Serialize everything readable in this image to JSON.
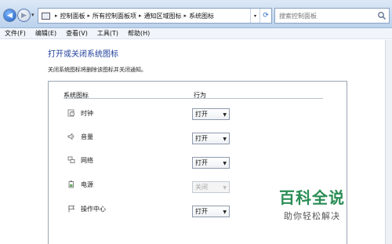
{
  "address_bar": {
    "breadcrumbs": [
      "控制面板",
      "所有控制面板项",
      "通知区域图标",
      "系统图标"
    ]
  },
  "search": {
    "placeholder": "搜索控制面板"
  },
  "menu": [
    "文件(F)",
    "编辑(E)",
    "查看(V)",
    "工具(T)",
    "帮助(H)"
  ],
  "page": {
    "title": "打开或关闭系统图标",
    "description": "关闭系统图标将删除该图标并关闭通知。"
  },
  "table": {
    "headers": {
      "icon": "系统图标",
      "behavior": "行为"
    },
    "rows": [
      {
        "icon": "clock-icon",
        "label": "时钟",
        "value": "打开",
        "enabled": true
      },
      {
        "icon": "volume-icon",
        "label": "音量",
        "value": "打开",
        "enabled": true
      },
      {
        "icon": "network-icon",
        "label": "网络",
        "value": "打开",
        "enabled": true
      },
      {
        "icon": "power-icon",
        "label": "电源",
        "value": "关闭",
        "enabled": false
      },
      {
        "icon": "action-center-flag-icon",
        "label": "操作中心",
        "value": "打开",
        "enabled": true
      }
    ]
  },
  "watermark": {
    "title": "百科全说",
    "subtitle": "助你轻松解决"
  },
  "colors": {
    "title_blue": "#1f3f9a",
    "watermark_green": "#2a8d55"
  }
}
